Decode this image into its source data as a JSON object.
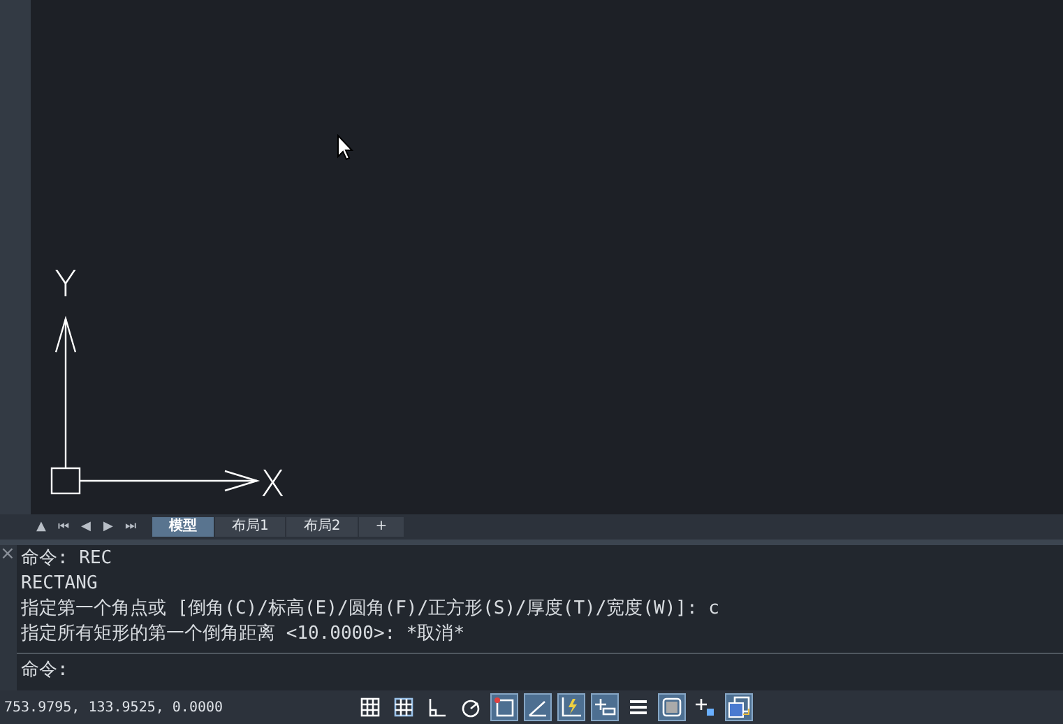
{
  "drawing_area": {
    "axis_labels": [
      "X",
      "Y"
    ]
  },
  "layout_tabs": {
    "nav": [
      {
        "label": "▲"
      },
      {
        "label": "⏮"
      },
      {
        "label": "◀"
      },
      {
        "label": "▶"
      },
      {
        "label": "⏭"
      }
    ],
    "tabs": [
      {
        "label": "模型",
        "selected": true
      },
      {
        "label": "布局1",
        "selected": false
      },
      {
        "label": "布局2",
        "selected": false
      },
      {
        "label": "+",
        "selected": false
      }
    ]
  },
  "command_window": {
    "close": "×",
    "history": [
      "命令: REC",
      "RECTANG",
      "指定第一个角点或 [倒角(C)/标高(E)/圆角(F)/正方形(S)/厚度(T)/宽度(W)]: c",
      "指定所有矩形的第一个倒角距离 <10.0000>: *取消*"
    ],
    "prompt": "命令:"
  },
  "status_bar": {
    "coordinates": "753.9795, 133.9525, 0.0000",
    "toggles": [
      {
        "kind": "grid",
        "on": false
      },
      {
        "kind": "snap",
        "on": false
      },
      {
        "kind": "ortho",
        "on": false
      },
      {
        "kind": "polar",
        "on": false
      },
      {
        "kind": "osnap",
        "on": true
      },
      {
        "kind": "angle",
        "on": true
      },
      {
        "kind": "dynamic",
        "on": true
      },
      {
        "kind": "plus",
        "on": true
      },
      {
        "kind": "lineweight",
        "on": false
      },
      {
        "kind": "checker",
        "on": true
      },
      {
        "kind": "select",
        "on": false
      },
      {
        "kind": "stack",
        "on": true
      }
    ]
  }
}
